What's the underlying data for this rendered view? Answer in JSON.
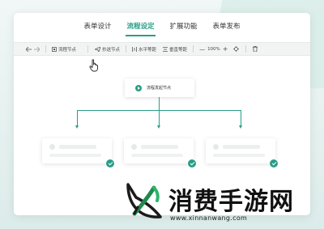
{
  "tabs": [
    {
      "label": "表单设计"
    },
    {
      "label": "流程设定"
    },
    {
      "label": "扩展功能"
    },
    {
      "label": "表单发布"
    }
  ],
  "toolbar": {
    "undo_icon": "undo-icon",
    "redo_icon": "redo-icon",
    "flow_node_label": "流程节点",
    "cc_node_label": "抄送节点",
    "h_spacing_label": "水平等距",
    "v_spacing_label": "垂直等距",
    "zoom_value": "100%",
    "zoom_out": "—",
    "zoom_in": "+"
  },
  "start_node": {
    "label": "流程发起节点"
  },
  "cards_count_shown": 3,
  "accent_color": "#2a9d86",
  "watermark": {
    "title": "消费手游网",
    "url": "www.xinnanwang.com"
  }
}
